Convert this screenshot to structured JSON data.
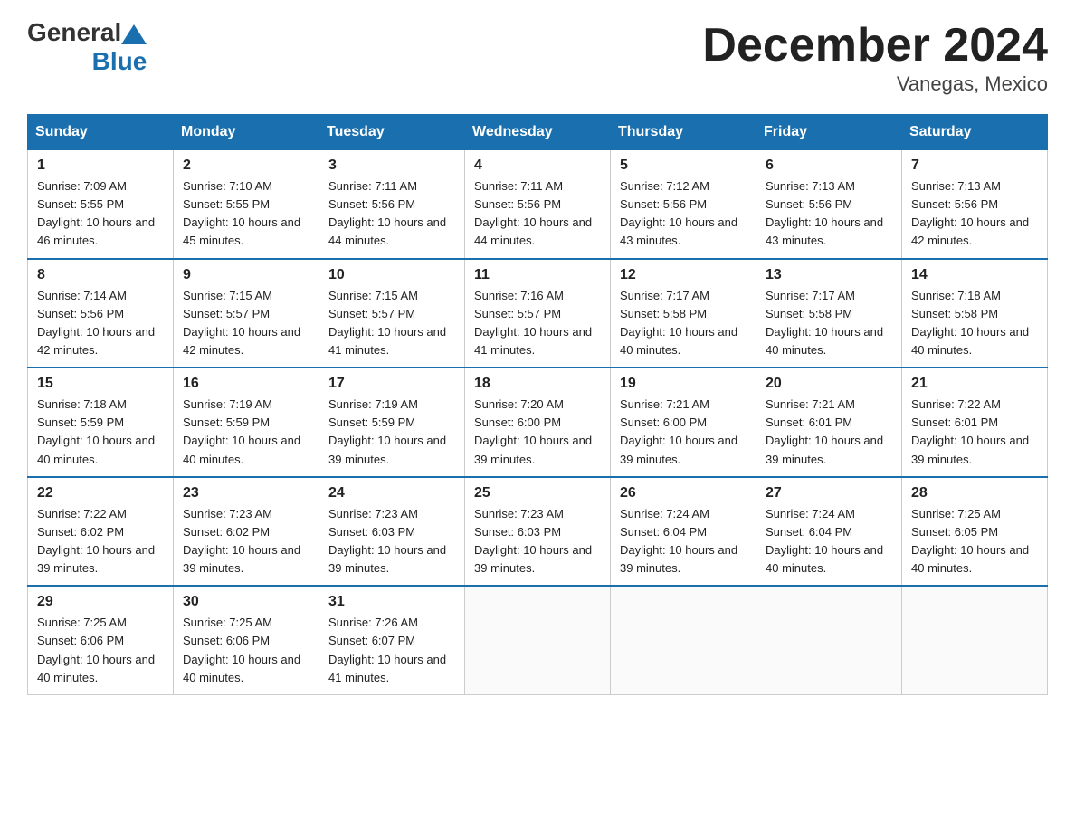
{
  "header": {
    "logo": {
      "general": "General",
      "blue": "Blue"
    },
    "title": "December 2024",
    "location": "Vanegas, Mexico"
  },
  "weekdays": [
    "Sunday",
    "Monday",
    "Tuesday",
    "Wednesday",
    "Thursday",
    "Friday",
    "Saturday"
  ],
  "weeks": [
    [
      {
        "day": "1",
        "sunrise": "7:09 AM",
        "sunset": "5:55 PM",
        "daylight": "10 hours and 46 minutes."
      },
      {
        "day": "2",
        "sunrise": "7:10 AM",
        "sunset": "5:55 PM",
        "daylight": "10 hours and 45 minutes."
      },
      {
        "day": "3",
        "sunrise": "7:11 AM",
        "sunset": "5:56 PM",
        "daylight": "10 hours and 44 minutes."
      },
      {
        "day": "4",
        "sunrise": "7:11 AM",
        "sunset": "5:56 PM",
        "daylight": "10 hours and 44 minutes."
      },
      {
        "day": "5",
        "sunrise": "7:12 AM",
        "sunset": "5:56 PM",
        "daylight": "10 hours and 43 minutes."
      },
      {
        "day": "6",
        "sunrise": "7:13 AM",
        "sunset": "5:56 PM",
        "daylight": "10 hours and 43 minutes."
      },
      {
        "day": "7",
        "sunrise": "7:13 AM",
        "sunset": "5:56 PM",
        "daylight": "10 hours and 42 minutes."
      }
    ],
    [
      {
        "day": "8",
        "sunrise": "7:14 AM",
        "sunset": "5:56 PM",
        "daylight": "10 hours and 42 minutes."
      },
      {
        "day": "9",
        "sunrise": "7:15 AM",
        "sunset": "5:57 PM",
        "daylight": "10 hours and 42 minutes."
      },
      {
        "day": "10",
        "sunrise": "7:15 AM",
        "sunset": "5:57 PM",
        "daylight": "10 hours and 41 minutes."
      },
      {
        "day": "11",
        "sunrise": "7:16 AM",
        "sunset": "5:57 PM",
        "daylight": "10 hours and 41 minutes."
      },
      {
        "day": "12",
        "sunrise": "7:17 AM",
        "sunset": "5:58 PM",
        "daylight": "10 hours and 40 minutes."
      },
      {
        "day": "13",
        "sunrise": "7:17 AM",
        "sunset": "5:58 PM",
        "daylight": "10 hours and 40 minutes."
      },
      {
        "day": "14",
        "sunrise": "7:18 AM",
        "sunset": "5:58 PM",
        "daylight": "10 hours and 40 minutes."
      }
    ],
    [
      {
        "day": "15",
        "sunrise": "7:18 AM",
        "sunset": "5:59 PM",
        "daylight": "10 hours and 40 minutes."
      },
      {
        "day": "16",
        "sunrise": "7:19 AM",
        "sunset": "5:59 PM",
        "daylight": "10 hours and 40 minutes."
      },
      {
        "day": "17",
        "sunrise": "7:19 AM",
        "sunset": "5:59 PM",
        "daylight": "10 hours and 39 minutes."
      },
      {
        "day": "18",
        "sunrise": "7:20 AM",
        "sunset": "6:00 PM",
        "daylight": "10 hours and 39 minutes."
      },
      {
        "day": "19",
        "sunrise": "7:21 AM",
        "sunset": "6:00 PM",
        "daylight": "10 hours and 39 minutes."
      },
      {
        "day": "20",
        "sunrise": "7:21 AM",
        "sunset": "6:01 PM",
        "daylight": "10 hours and 39 minutes."
      },
      {
        "day": "21",
        "sunrise": "7:22 AM",
        "sunset": "6:01 PM",
        "daylight": "10 hours and 39 minutes."
      }
    ],
    [
      {
        "day": "22",
        "sunrise": "7:22 AM",
        "sunset": "6:02 PM",
        "daylight": "10 hours and 39 minutes."
      },
      {
        "day": "23",
        "sunrise": "7:23 AM",
        "sunset": "6:02 PM",
        "daylight": "10 hours and 39 minutes."
      },
      {
        "day": "24",
        "sunrise": "7:23 AM",
        "sunset": "6:03 PM",
        "daylight": "10 hours and 39 minutes."
      },
      {
        "day": "25",
        "sunrise": "7:23 AM",
        "sunset": "6:03 PM",
        "daylight": "10 hours and 39 minutes."
      },
      {
        "day": "26",
        "sunrise": "7:24 AM",
        "sunset": "6:04 PM",
        "daylight": "10 hours and 39 minutes."
      },
      {
        "day": "27",
        "sunrise": "7:24 AM",
        "sunset": "6:04 PM",
        "daylight": "10 hours and 40 minutes."
      },
      {
        "day": "28",
        "sunrise": "7:25 AM",
        "sunset": "6:05 PM",
        "daylight": "10 hours and 40 minutes."
      }
    ],
    [
      {
        "day": "29",
        "sunrise": "7:25 AM",
        "sunset": "6:06 PM",
        "daylight": "10 hours and 40 minutes."
      },
      {
        "day": "30",
        "sunrise": "7:25 AM",
        "sunset": "6:06 PM",
        "daylight": "10 hours and 40 minutes."
      },
      {
        "day": "31",
        "sunrise": "7:26 AM",
        "sunset": "6:07 PM",
        "daylight": "10 hours and 41 minutes."
      },
      null,
      null,
      null,
      null
    ]
  ]
}
